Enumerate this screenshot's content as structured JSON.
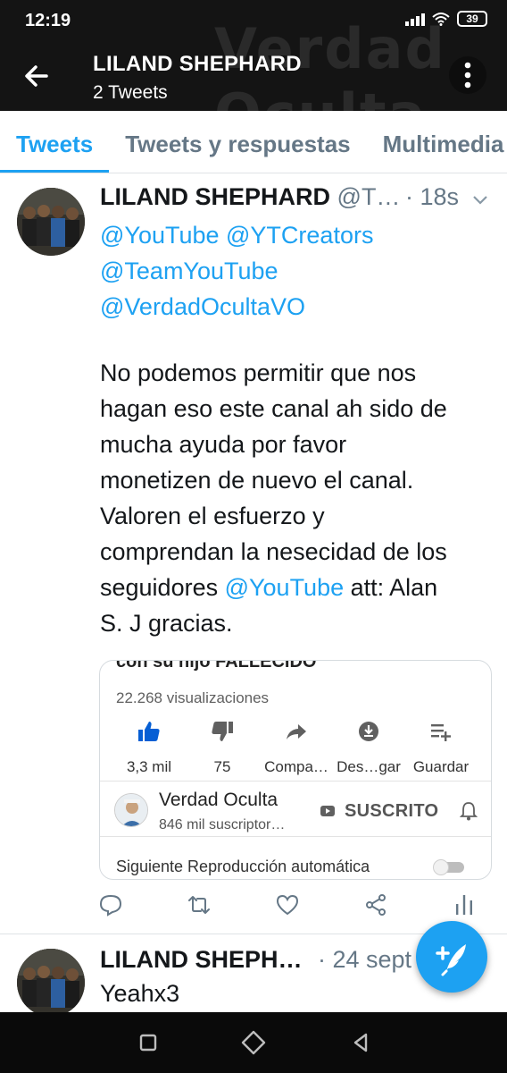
{
  "status_bar": {
    "time": "12:19",
    "battery": "39"
  },
  "header": {
    "title": "LILAND SHEPHARD",
    "subtitle": "2 Tweets",
    "background_text": "Verdad Oculta"
  },
  "tabs": [
    {
      "label": "Tweets",
      "active": true
    },
    {
      "label": "Tweets y respuestas",
      "active": false
    },
    {
      "label": "Multimedia",
      "active": false
    }
  ],
  "tweet": {
    "name": "LILAND SHEPHARD",
    "handle": "@T…",
    "time": "· 18s",
    "mentions": [
      "@YouTube @YTCreators",
      "@TeamYouTube",
      "@VerdadOcultaVO"
    ],
    "body_lines": [
      "No podemos permitir que nos",
      "hagan eso este canal ah sido de",
      "mucha ayuda por favor",
      "monetizen de nuevo el canal.",
      "Valoren el esfuerzo y",
      "comprendan la nesecidad de los"
    ],
    "body_tail_pre": "seguidores ",
    "body_tail_mention": "@YouTube",
    "body_tail_post": " att: Alan",
    "body_last": "S. J gracias.",
    "card": {
      "video_title": "con su hijo FALLECIDO",
      "views": "22.268 visualizaciones",
      "actions": [
        {
          "icon": "thumbs-up-icon",
          "label": "3,3 mil"
        },
        {
          "icon": "thumbs-down-icon",
          "label": "75"
        },
        {
          "icon": "share-arrow-icon",
          "label": "Compa…"
        },
        {
          "icon": "download-icon",
          "label": "Des…gar"
        },
        {
          "icon": "playlist-add-icon",
          "label": "Guardar"
        }
      ],
      "channel_name": "Verdad Oculta",
      "channel_subs": "846 mil suscriptor…",
      "subscribe_label": "SUSCRITO",
      "autoplay_label": "Siguiente Reproducción automática",
      "autoplay_on": false
    }
  },
  "tweet2": {
    "name": "LILAND SHEPH…",
    "time": "· 24 sept",
    "body": "Yeahx3"
  },
  "colors": {
    "accent": "#1da1f2",
    "header_bg": "#141414",
    "muted": "#657786",
    "youtube_blue": "#065fd4"
  }
}
